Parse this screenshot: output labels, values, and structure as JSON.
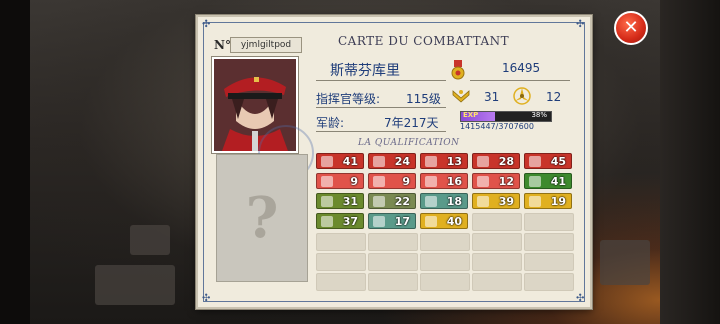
{
  "card": {
    "no_label": "N°",
    "username": "yjmlgiltpod",
    "title": "CARTE DU COMBATTANT",
    "name": "斯蒂芬库里",
    "score": "16495",
    "rank_label": "指挥官等级:",
    "rank_value": "115级",
    "chevron_count": "31",
    "propeller_count": "12",
    "age_label": "军龄:",
    "age_value": "7年217天",
    "exp_label": "EXP",
    "exp_percent": "38%",
    "exp_fraction": 0.38,
    "exp_numbers": "1415447/3707600",
    "qualification_title": "LA QUALIFICATION",
    "question_mark": "?"
  },
  "badges": [
    {
      "value": "41",
      "color": "#c8342a",
      "icon": "grenade-icon"
    },
    {
      "value": "24",
      "color": "#c8342a",
      "icon": "ammo-icon"
    },
    {
      "value": "13",
      "color": "#c8342a",
      "icon": "missile-icon"
    },
    {
      "value": "28",
      "color": "#c8342a",
      "icon": "shell-icon"
    },
    {
      "value": "45",
      "color": "#c8342a",
      "icon": "wrench-icon"
    },
    {
      "value": "9",
      "color": "#e0534a",
      "icon": "mortar-icon"
    },
    {
      "value": "9",
      "color": "#e0534a",
      "icon": "cartridge-icon"
    },
    {
      "value": "16",
      "color": "#e0534a",
      "icon": "rocket-icon"
    },
    {
      "value": "12",
      "color": "#e0534a",
      "icon": "tool-icon"
    },
    {
      "value": "41",
      "color": "#3e8a2e",
      "icon": "book-icon"
    },
    {
      "value": "31",
      "color": "#6b8a2e",
      "icon": "tank-icon"
    },
    {
      "value": "22",
      "color": "#7a8a52",
      "icon": "crate-icon"
    },
    {
      "value": "18",
      "color": "#5a9a8a",
      "icon": "gear-icon"
    },
    {
      "value": "39",
      "color": "#e0b020",
      "icon": "truck-icon"
    },
    {
      "value": "19",
      "color": "#e0b020",
      "icon": "plane-icon"
    },
    {
      "value": "37",
      "color": "#6b8a2e",
      "icon": "soldier-icon"
    },
    {
      "value": "17",
      "color": "#5a9a8a",
      "icon": "wheel-icon"
    },
    {
      "value": "40",
      "color": "#e0b020",
      "icon": "flag-icon"
    }
  ],
  "close_label": "✕"
}
